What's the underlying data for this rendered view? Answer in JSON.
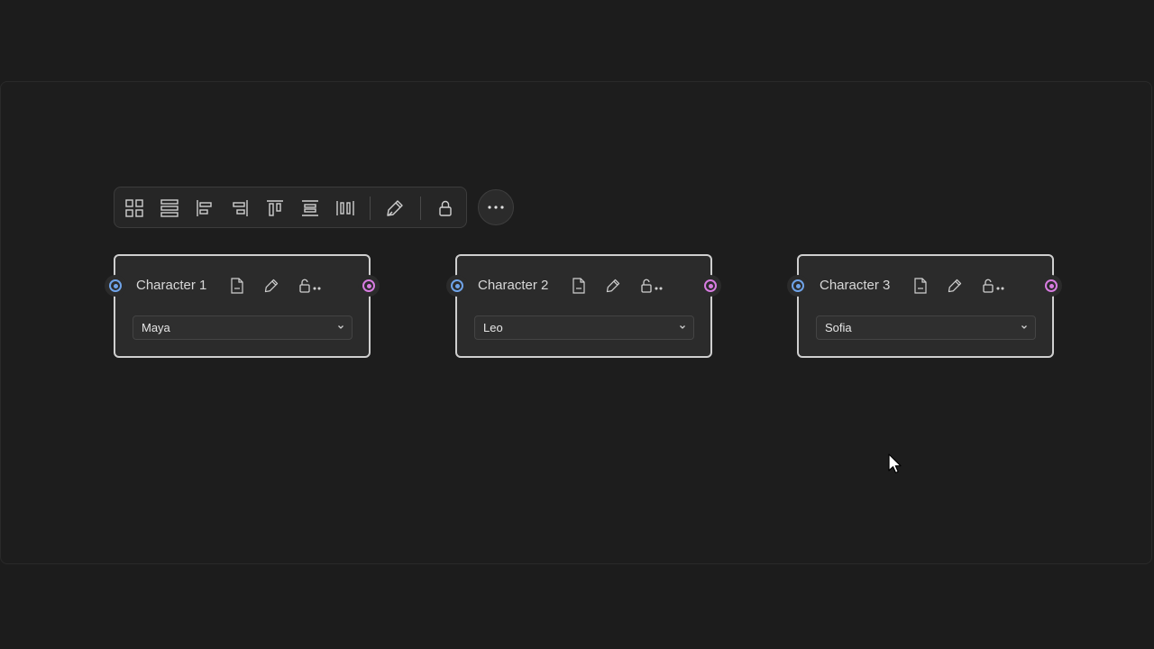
{
  "toolbar": {
    "tools": [
      {
        "icon": "grid-layout-icon"
      },
      {
        "icon": "stack-rows-icon"
      },
      {
        "icon": "align-left-icon"
      },
      {
        "icon": "align-right-icon"
      },
      {
        "icon": "align-top-icon"
      },
      {
        "icon": "align-center-vertical-icon"
      },
      {
        "icon": "distribute-horizontal-icon"
      },
      {
        "icon": "pen-icon"
      },
      {
        "icon": "lock-icon"
      }
    ],
    "more_icon": "more-horizontal-icon"
  },
  "nodes": [
    {
      "title": "Character 1",
      "value": "Maya"
    },
    {
      "title": "Character 2",
      "value": "Leo"
    },
    {
      "title": "Character 3",
      "value": "Sofia"
    }
  ],
  "colors": {
    "input_port": "#6fa3e8",
    "output_port": "#d77ce0",
    "node_border": "#cfcfcf",
    "background": "#1c1c1c"
  }
}
